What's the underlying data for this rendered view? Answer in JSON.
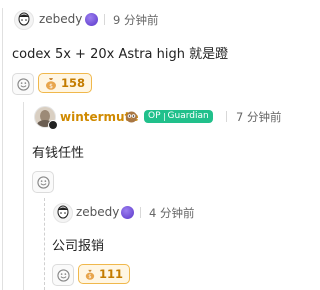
{
  "comments": [
    {
      "username": "zebedy",
      "time": "9 分钟前",
      "content": "codex 5x + 20x Astra high 就是蹬",
      "reaction_count": "158"
    },
    {
      "username": "wintermute",
      "op_label": "OP",
      "role_label": "Guardian",
      "time": "7 分钟前",
      "content": "有钱任性"
    },
    {
      "username": "zebedy",
      "time": "4 分钟前",
      "content": "公司报销",
      "reaction_count": "111"
    }
  ],
  "colors": {
    "accent_gold": "#d08a00",
    "op_badge": "#21c08b",
    "reaction_border": "#f0b84c",
    "reaction_bg": "#fff6e3"
  },
  "icons": {
    "emoji_add": "smiley-icon",
    "reaction": "money-bag-icon",
    "user_badge": "purple-orb-icon",
    "owl_badge": "owl-icon"
  }
}
